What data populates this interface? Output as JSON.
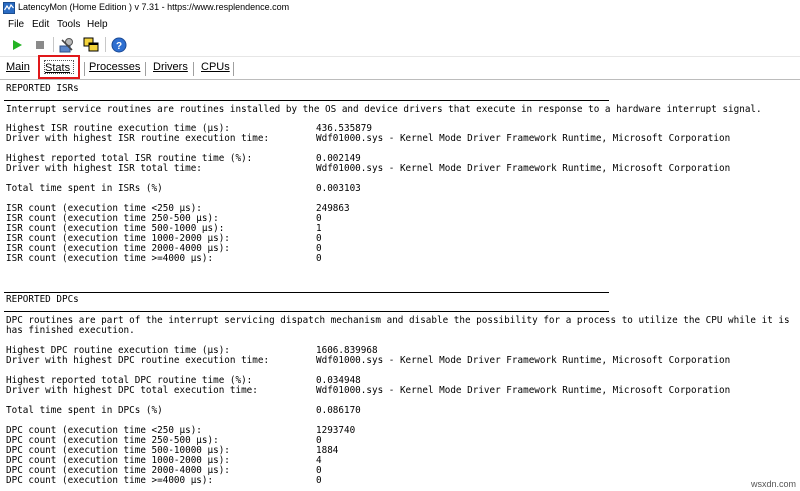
{
  "window": {
    "title": "LatencyMon  (Home Edition )  v 7.31 - https://www.resplendence.com"
  },
  "menu": {
    "file": "File",
    "edit": "Edit",
    "tools": "Tools",
    "help": "Help"
  },
  "tabs": {
    "main": "Main",
    "stats": "Stats",
    "processes": "Processes",
    "drivers": "Drivers",
    "cpus": "CPUs"
  },
  "isr": {
    "header": "REPORTED ISRs",
    "description": "Interrupt service routines are routines installed by the OS and device drivers that execute in response to a hardware interrupt signal.",
    "rows": [
      {
        "label": "Highest ISR routine execution time (µs):",
        "value": "436.535879"
      },
      {
        "label": "Driver with highest ISR routine execution time:",
        "value": "Wdf01000.sys - Kernel Mode Driver Framework Runtime, Microsoft Corporation"
      },
      {
        "label": "Highest reported total ISR routine time (%):",
        "value": "0.002149"
      },
      {
        "label": "Driver with highest ISR total time:",
        "value": "Wdf01000.sys - Kernel Mode Driver Framework Runtime, Microsoft Corporation"
      },
      {
        "label": "Total time spent in ISRs (%)",
        "value": "0.003103"
      },
      {
        "label": "ISR count (execution time <250 µs):",
        "value": "249863"
      },
      {
        "label": "ISR count (execution time 250-500 µs):",
        "value": "0"
      },
      {
        "label": "ISR count (execution time 500-1000 µs):",
        "value": "1"
      },
      {
        "label": "ISR count (execution time 1000-2000 µs):",
        "value": "0"
      },
      {
        "label": "ISR count (execution time 2000-4000 µs):",
        "value": "0"
      },
      {
        "label": "ISR count (execution time >=4000 µs):",
        "value": "0"
      }
    ]
  },
  "dpc": {
    "header": "REPORTED DPCs",
    "description1": "DPC routines are part of the interrupt servicing dispatch mechanism and disable the possibility for a process to utilize the CPU while it is",
    "description2": "has finished execution.",
    "rows": [
      {
        "label": "Highest DPC routine execution time (µs):",
        "value": "1606.839968"
      },
      {
        "label": "Driver with highest DPC routine execution time:",
        "value": "Wdf01000.sys - Kernel Mode Driver Framework Runtime, Microsoft Corporation"
      },
      {
        "label": "Highest reported total DPC routine time (%):",
        "value": "0.034948"
      },
      {
        "label": "Driver with highest DPC total execution time:",
        "value": "Wdf01000.sys - Kernel Mode Driver Framework Runtime, Microsoft Corporation"
      },
      {
        "label": "Total time spent in DPCs (%)",
        "value": "0.086170"
      },
      {
        "label": "DPC count (execution time <250 µs):",
        "value": "1293740"
      },
      {
        "label": "DPC count (execution time 250-500 µs):",
        "value": "0"
      },
      {
        "label": "DPC count (execution time 500-10000 µs):",
        "value": "1884"
      },
      {
        "label": "DPC count (execution time 1000-2000 µs):",
        "value": "4"
      },
      {
        "label": "DPC count (execution time 2000-4000 µs):",
        "value": "0"
      },
      {
        "label": "DPC count (execution time >=4000 µs):",
        "value": "0"
      }
    ]
  },
  "watermark": "wsxdn.com"
}
